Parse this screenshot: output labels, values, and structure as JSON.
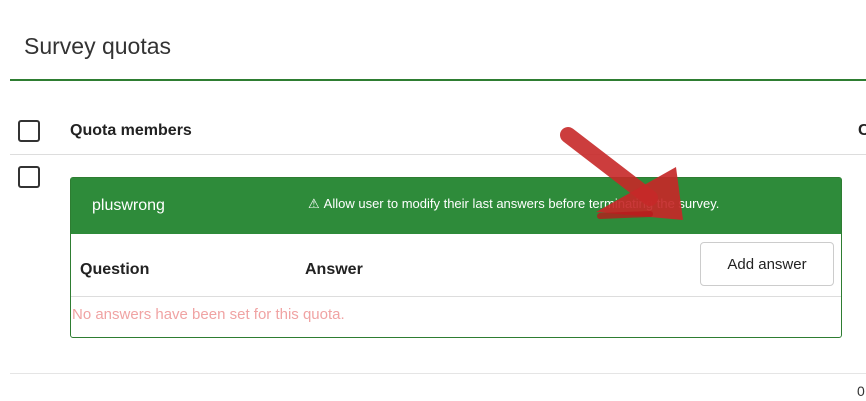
{
  "page": {
    "title": "Survey quotas"
  },
  "table": {
    "header_label": "Quota members",
    "header_cut": "C"
  },
  "quota": {
    "name": "pluswrong",
    "note_icon": "warning-icon",
    "note": "Allow user to modify their last answers before terminating the survey.",
    "col_question": "Question",
    "col_answer": "Answer",
    "add_answer_label": "Add answer",
    "empty_message": "No answers have been set for this quota."
  },
  "footer": {
    "count": "0"
  },
  "colors": {
    "accent": "#2e8b3a",
    "rule": "#2e7d32",
    "empty_text": "#f0a3a3",
    "annotation_arrow": "#c62828"
  }
}
